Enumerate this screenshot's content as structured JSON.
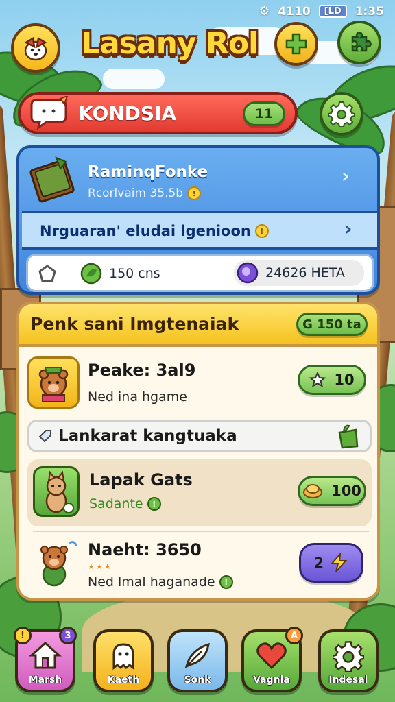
{
  "status_bar": {
    "time_left": "4110",
    "battery": "[LD",
    "time_right": "1:35"
  },
  "header": {
    "title": "Lasany Rol"
  },
  "banner": {
    "name": "KONDSIA",
    "count": "11"
  },
  "blue_panel": {
    "title": "RaminqFonke",
    "subtitle": "Rcorlvaim 35.5b",
    "row_text": "Nrguaran' eludai lgenioon",
    "stat_left": "150 cns",
    "stat_right": "24626 HETA"
  },
  "card": {
    "title": "Penk sani Imgtenaiak",
    "title_pill": "G 150 ta",
    "items": [
      {
        "title": "Peake: 3al9",
        "subtitle": "Ned ina hgame",
        "button": "10"
      },
      {
        "title": "Lapak Gats",
        "subtitle": "Sadante",
        "button": "100"
      },
      {
        "title": "Naeht: 3650",
        "subtitle": "Ned lmal haganade",
        "button": "2",
        "stars": "★★★"
      }
    ],
    "section": "Lankarat kangtuaka"
  },
  "nav": [
    {
      "label": "Marsh",
      "badge_left": "",
      "badge_right": "3",
      "color": "#e77ad0"
    },
    {
      "label": "Kaeth",
      "badge_left": "",
      "badge_right": "",
      "color": "#ffcb2d"
    },
    {
      "label": "Sonk",
      "badge_left": "",
      "badge_right": "",
      "color": "#8ec8f0"
    },
    {
      "label": "Vagnia",
      "badge_left": "",
      "badge_right": "A",
      "color": "#6cc256"
    },
    {
      "label": "Indesal",
      "badge_left": "",
      "badge_right": "",
      "color": "#6cc256"
    }
  ],
  "colors": {
    "banner": "#e23b32",
    "panel": "#3f84dd",
    "card_head": "#f5c21f",
    "nav_pink": "#e77ad0",
    "nav_yellow": "#ffcb2d",
    "nav_blue": "#8ec8f0",
    "nav_green": "#6cc256"
  },
  "icons": [
    "dog-avatar-icon",
    "plus-icon",
    "puzzle-icon",
    "chat-bubble-icon",
    "gear-icon",
    "book-icon",
    "chevron-right-icon",
    "leaf-icon",
    "gem-icon",
    "star-icon",
    "bun-icon",
    "home-icon",
    "ghost-icon",
    "feather-icon",
    "heart-icon"
  ]
}
